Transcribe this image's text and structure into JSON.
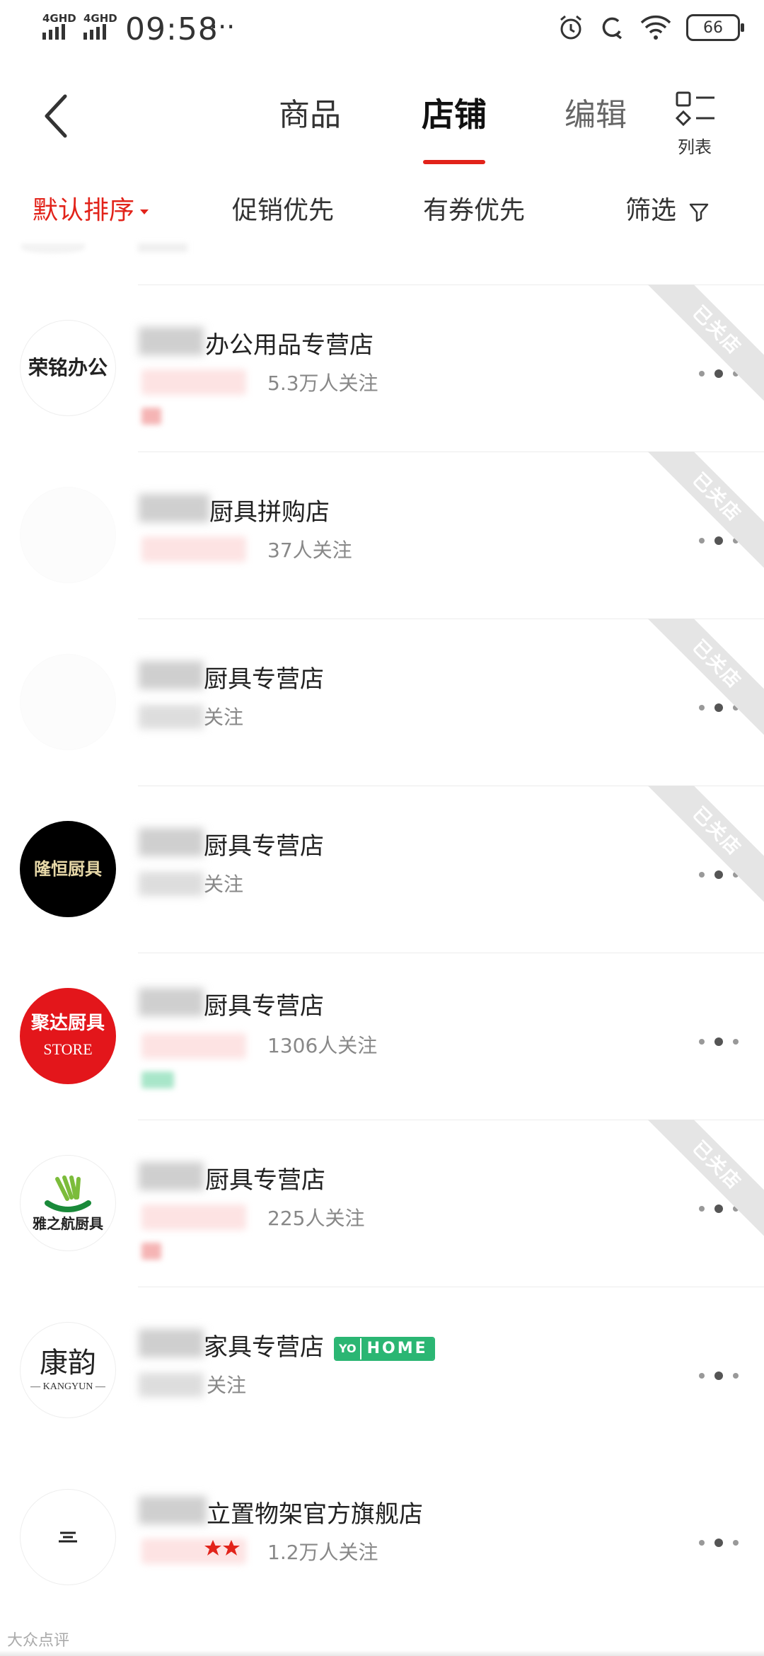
{
  "status_bar": {
    "network_1": "4GHD",
    "network_2": "4GHD",
    "time": "09:58",
    "more": "···",
    "battery": "66"
  },
  "header": {
    "tabs": [
      {
        "label": "商品"
      },
      {
        "label": "店铺"
      },
      {
        "label": "编辑"
      }
    ],
    "list_view_label": "列表"
  },
  "filters": [
    {
      "label": "默认排序"
    },
    {
      "label": "促销优先"
    },
    {
      "label": "有券优先"
    },
    {
      "label": "筛选"
    }
  ],
  "stores": [
    {
      "name_visible": "办公用品专营店",
      "logo_text": "荣铭办公",
      "followers": "5.3万人关注",
      "closed": true,
      "ribbon": "已关店"
    },
    {
      "name_visible": "厨具拼购店",
      "logo_text": "",
      "followers": "37人关注",
      "closed": true,
      "ribbon": "已关店"
    },
    {
      "name_visible": "厨具专营店",
      "logo_text": "",
      "followers": "关注",
      "closed": true,
      "ribbon": "已关店"
    },
    {
      "name_visible": "厨具专营店",
      "logo_text": "隆恒厨具",
      "followers": "关注",
      "closed": true,
      "ribbon": "已关店"
    },
    {
      "name_visible": "厨具专营店",
      "logo_text": "聚达厨具",
      "logo_sub": "STORE",
      "followers": "1306人关注",
      "closed": false
    },
    {
      "name_visible": "厨具专营店",
      "logo_text": "雅之航厨具",
      "followers": "225人关注",
      "closed": true,
      "ribbon": "已关店"
    },
    {
      "name_visible": "家具专营店",
      "logo_text": "康韵",
      "logo_sub": "— KANGYUN —",
      "followers": "关注",
      "closed": false,
      "badge": {
        "yo": "YO",
        "home": "HOME"
      }
    },
    {
      "name_visible": "立置物架官方旗舰店",
      "logo_text": "",
      "followers": "1.2万人关注",
      "closed": false
    }
  ],
  "watermark": "大众点评",
  "colors": {
    "accent": "#e2231a",
    "closed_ribbon": "#e5e5e5",
    "home_green": "#2bb673"
  }
}
